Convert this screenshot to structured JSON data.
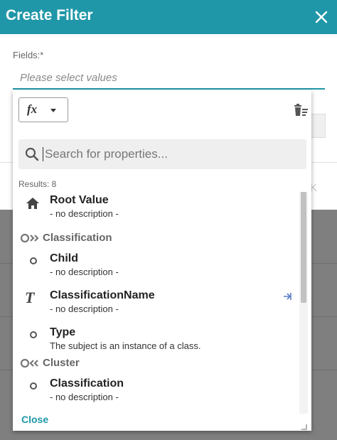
{
  "dialog": {
    "title": "Create Filter",
    "fields_label": "Fields:*",
    "fields_placeholder": "Please select values",
    "behind_button_text": "K"
  },
  "toolbar": {
    "function_button_label": "fx",
    "function_icon": "function-icon",
    "clear_icon": "trash-list-icon"
  },
  "search": {
    "placeholder": "Search for properties..."
  },
  "results": {
    "count_label": "Results: 8"
  },
  "list": {
    "items": [
      {
        "kind": "item",
        "icon": "home-icon",
        "title": "Root Value",
        "desc": "- no description -"
      },
      {
        "kind": "group",
        "icon": "outgoing-relation-icon",
        "label": "Classification"
      },
      {
        "kind": "item",
        "icon": "circle-icon",
        "title": "Child",
        "desc": "- no description -"
      },
      {
        "kind": "item",
        "icon": "text-type-icon",
        "title": "ClassificationName",
        "desc": "- no description -",
        "action_icon": "pin-icon"
      },
      {
        "kind": "item",
        "icon": "circle-icon",
        "title": "Type",
        "desc": "The subject is an instance of a class."
      },
      {
        "kind": "group",
        "icon": "incoming-relation-icon",
        "label": "Cluster"
      },
      {
        "kind": "item",
        "icon": "circle-icon",
        "title": "Classification",
        "desc": "- no description -"
      }
    ]
  },
  "footer": {
    "close_label": "Close"
  },
  "colors": {
    "accent": "#1f97a8",
    "overlay": "#7f7f7f"
  }
}
